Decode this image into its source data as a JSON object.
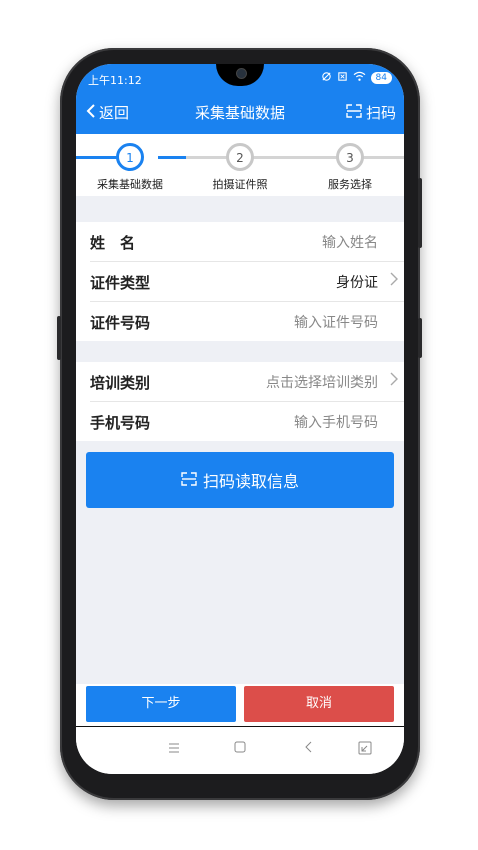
{
  "status": {
    "time": "上午11:12",
    "battery": "84"
  },
  "header": {
    "back_label": "返回",
    "title": "采集基础数据",
    "scan_label": "扫码"
  },
  "stepper": {
    "steps": [
      {
        "number": "1",
        "label": "采集基础数据"
      },
      {
        "number": "2",
        "label": "拍摄证件照"
      },
      {
        "number": "3",
        "label": "服务选择"
      }
    ],
    "active_index": 0
  },
  "form": {
    "group1": [
      {
        "label": "姓　名",
        "value": "输入姓名"
      },
      {
        "label": "证件类型",
        "value": "身份证"
      },
      {
        "label": "证件号码",
        "value": "输入证件号码"
      }
    ],
    "group2": [
      {
        "label": "培训类别",
        "value": "点击选择培训类别"
      },
      {
        "label": "手机号码",
        "value": "输入手机号码"
      }
    ]
  },
  "scan_read_label": "扫码读取信息",
  "actions": {
    "next_label": "下一步",
    "cancel_label": "取消"
  },
  "colors": {
    "primary": "#1a82f0",
    "danger": "#dc4e4a",
    "background": "#eef0f5"
  },
  "icons": [
    "back-chevron-icon",
    "scan-icon",
    "chevron-right-icon",
    "menu-icon",
    "home-icon",
    "back-nav-icon",
    "recent-apps-icon"
  ]
}
